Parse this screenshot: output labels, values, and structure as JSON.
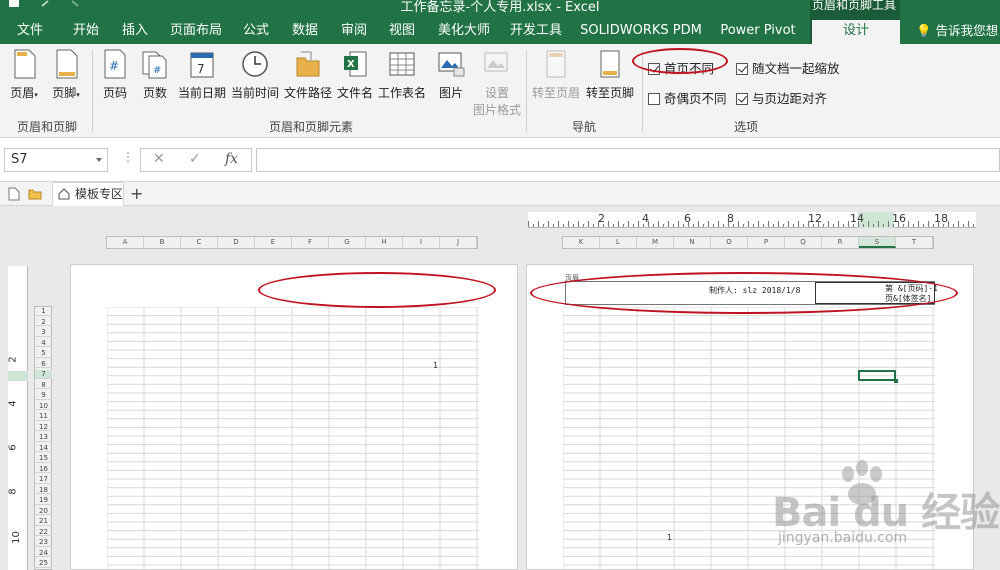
{
  "window": {
    "title": "工作备忘录-个人专用.xlsx - Excel",
    "contextual_group": "页眉和页脚工具"
  },
  "tabs": [
    {
      "label": "文件"
    },
    {
      "label": "开始"
    },
    {
      "label": "插入"
    },
    {
      "label": "页面布局"
    },
    {
      "label": "公式"
    },
    {
      "label": "数据"
    },
    {
      "label": "审阅"
    },
    {
      "label": "视图"
    },
    {
      "label": "美化大师"
    },
    {
      "label": "开发工具"
    },
    {
      "label": "SOLIDWORKS PDM"
    },
    {
      "label": "Power Pivot"
    },
    {
      "label": "设计"
    }
  ],
  "tell_me": "告诉我您想",
  "ribbon": {
    "header_footer": {
      "header": "页眉",
      "footer": "页脚",
      "group": "页眉和页脚"
    },
    "elements": {
      "page_number": "页码",
      "page_count": "页数",
      "current_date": "当前日期",
      "current_time": "当前时间",
      "file_path": "文件路径",
      "file_name": "文件名",
      "sheet_name": "工作表名",
      "picture": "图片",
      "format_picture_1": "设置",
      "format_picture_2": "图片格式",
      "group": "页眉和页脚元素"
    },
    "navigation": {
      "goto_header": "转至页眉",
      "goto_footer": "转至页脚",
      "group": "导航"
    },
    "options": {
      "different_first": "首页不同",
      "scale_with_doc": "随文档一起缩放",
      "different_odd_even": "奇偶页不同",
      "align_margins": "与页边距对齐",
      "group": "选项",
      "different_first_checked": true,
      "scale_with_doc_checked": true,
      "different_odd_even_checked": false,
      "align_margins_checked": true
    }
  },
  "formula_bar": {
    "name_box": "S7",
    "fx": "fx",
    "cancel": "✕",
    "enter": "✓",
    "value": ""
  },
  "sheet_tabs": {
    "active": "模板专区",
    "add": "+"
  },
  "ruler": {
    "numbers": [
      "2",
      "4",
      "6",
      "8",
      "12",
      "14",
      "16",
      "18"
    ]
  },
  "vruler": {
    "numbers": [
      "2",
      "4",
      "6",
      "8",
      "10"
    ]
  },
  "columns_page1": [
    "A",
    "B",
    "C",
    "D",
    "E",
    "F",
    "G",
    "H",
    "I",
    "J"
  ],
  "columns_page2": [
    "K",
    "L",
    "M",
    "N",
    "O",
    "P",
    "Q",
    "R",
    "S",
    "T"
  ],
  "rows": [
    "1",
    "2",
    "3",
    "4",
    "5",
    "6",
    "7",
    "8",
    "9",
    "10",
    "11",
    "12",
    "13",
    "14",
    "15",
    "16",
    "17",
    "18",
    "19",
    "20",
    "21",
    "22",
    "23",
    "24",
    "25"
  ],
  "page1": {
    "cell_value": "1"
  },
  "page2": {
    "header_label": "页眉",
    "header_center": "制作人: slz 2018/1/8",
    "header_right_line1": "第 &[页码]-1",
    "header_right_line2": "页&[体签名]",
    "cell_value": "1"
  },
  "colors": {
    "excel_green": "#217346",
    "highlight_red": "#c1121f"
  },
  "watermark": {
    "brand": "Bai du 经验",
    "url": "jingyan.baidu.com"
  }
}
